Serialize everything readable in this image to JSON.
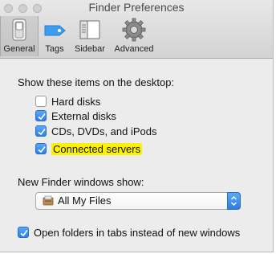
{
  "window": {
    "title": "Finder Preferences"
  },
  "toolbar": {
    "tabs": [
      {
        "label": "General",
        "icon": "general-switch-icon",
        "selected": true
      },
      {
        "label": "Tags",
        "icon": "tag-icon",
        "selected": false
      },
      {
        "label": "Sidebar",
        "icon": "sidebar-icon",
        "selected": false
      },
      {
        "label": "Advanced",
        "icon": "gear-icon",
        "selected": false
      }
    ]
  },
  "desktop": {
    "heading": "Show these items on the desktop:",
    "items": [
      {
        "label": "Hard disks",
        "checked": false
      },
      {
        "label": "External disks",
        "checked": true
      },
      {
        "label": "CDs, DVDs, and iPods",
        "checked": true
      },
      {
        "label": "Connected servers",
        "checked": true,
        "highlight": "#fff200"
      }
    ]
  },
  "new_window": {
    "heading": "New Finder windows show:",
    "selected": "All My Files",
    "icon": "all-my-files-icon"
  },
  "tabs_option": {
    "label": "Open folders in tabs instead of new windows",
    "checked": true
  },
  "colors": {
    "accent": "#2b7fe6",
    "highlight": "#fff200"
  }
}
